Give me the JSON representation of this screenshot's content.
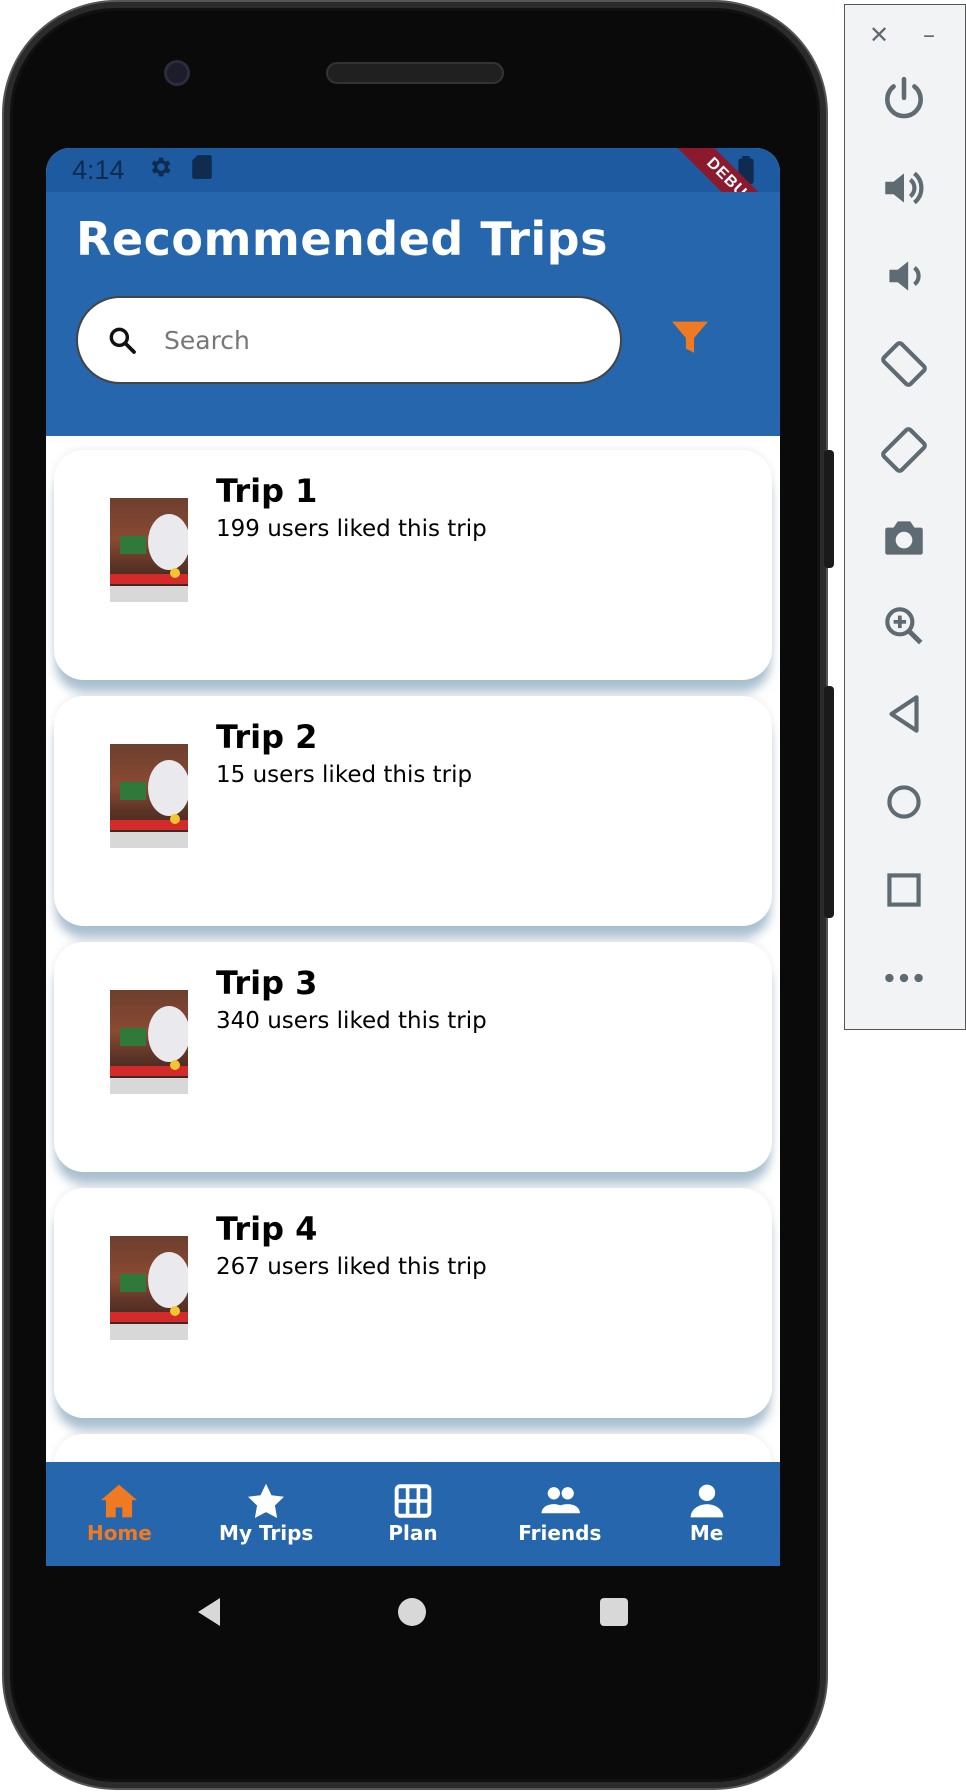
{
  "status_bar": {
    "time": "4:14",
    "debug_label": "DEBUG"
  },
  "header": {
    "title": "Recommended Trips",
    "search_placeholder": "Search"
  },
  "trips": [
    {
      "name": "Trip 1",
      "likes": "199 users liked this trip"
    },
    {
      "name": "Trip 2",
      "likes": "15 users liked this trip"
    },
    {
      "name": "Trip 3",
      "likes": "340 users liked this trip"
    },
    {
      "name": "Trip 4",
      "likes": "267 users liked this trip"
    }
  ],
  "bottom_nav": {
    "items": [
      {
        "label": "Home",
        "icon": "home-icon",
        "active": true
      },
      {
        "label": "My Trips",
        "icon": "star-icon",
        "active": false
      },
      {
        "label": "Plan",
        "icon": "grid-icon",
        "active": false
      },
      {
        "label": "Friends",
        "icon": "people-icon",
        "active": false
      },
      {
        "label": "Me",
        "icon": "person-icon",
        "active": false
      }
    ]
  },
  "emulator_panel": {
    "controls": [
      "power-icon",
      "volume-up-icon",
      "volume-down-icon",
      "rotate-left-icon",
      "rotate-right-icon",
      "camera-icon",
      "zoom-icon",
      "back-icon",
      "home-icon",
      "overview-icon",
      "more-icon"
    ]
  },
  "colors": {
    "primary": "#2566ac",
    "accent": "#f07a21",
    "status_bar": "#1d5aa0"
  }
}
